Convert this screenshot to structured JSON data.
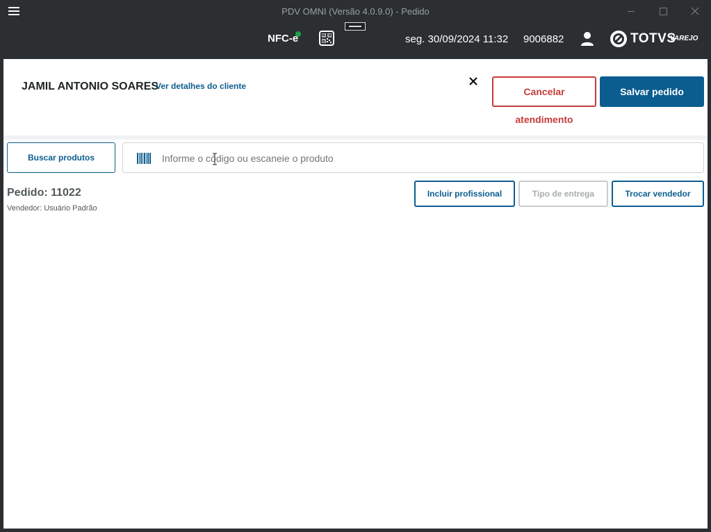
{
  "window": {
    "title": "PDV OMNI (Versão 4.0.9.0) - Pedido"
  },
  "header": {
    "nfce_label": "NFC-e",
    "nfce_status_color": "#17a34a",
    "datetime": "seg. 30/09/2024 11:32",
    "store_code": "9006882",
    "brand_name": "TOTVS",
    "brand_sub": "VAREJO"
  },
  "customer": {
    "name": "JAMIL ANTONIO SOARES",
    "details_link": "Ver detalhes do cliente"
  },
  "actions": {
    "cancel_label": "Cancelar atendimento",
    "save_label": "Salvar pedido"
  },
  "search": {
    "button_label": "Buscar produtos",
    "placeholder": "Informe o código ou escaneie o produto"
  },
  "order": {
    "number_label": "Pedido: 11022",
    "seller_label": "Vendedor: Usuário Padrão",
    "include_professional_label": "Incluir profissional",
    "delivery_type_label": "Tipo de entrega",
    "change_seller_label": "Trocar vendedor"
  },
  "colors": {
    "primary": "#0b5d8f",
    "danger": "#c73a3a",
    "header_bg": "#2b2f31"
  }
}
